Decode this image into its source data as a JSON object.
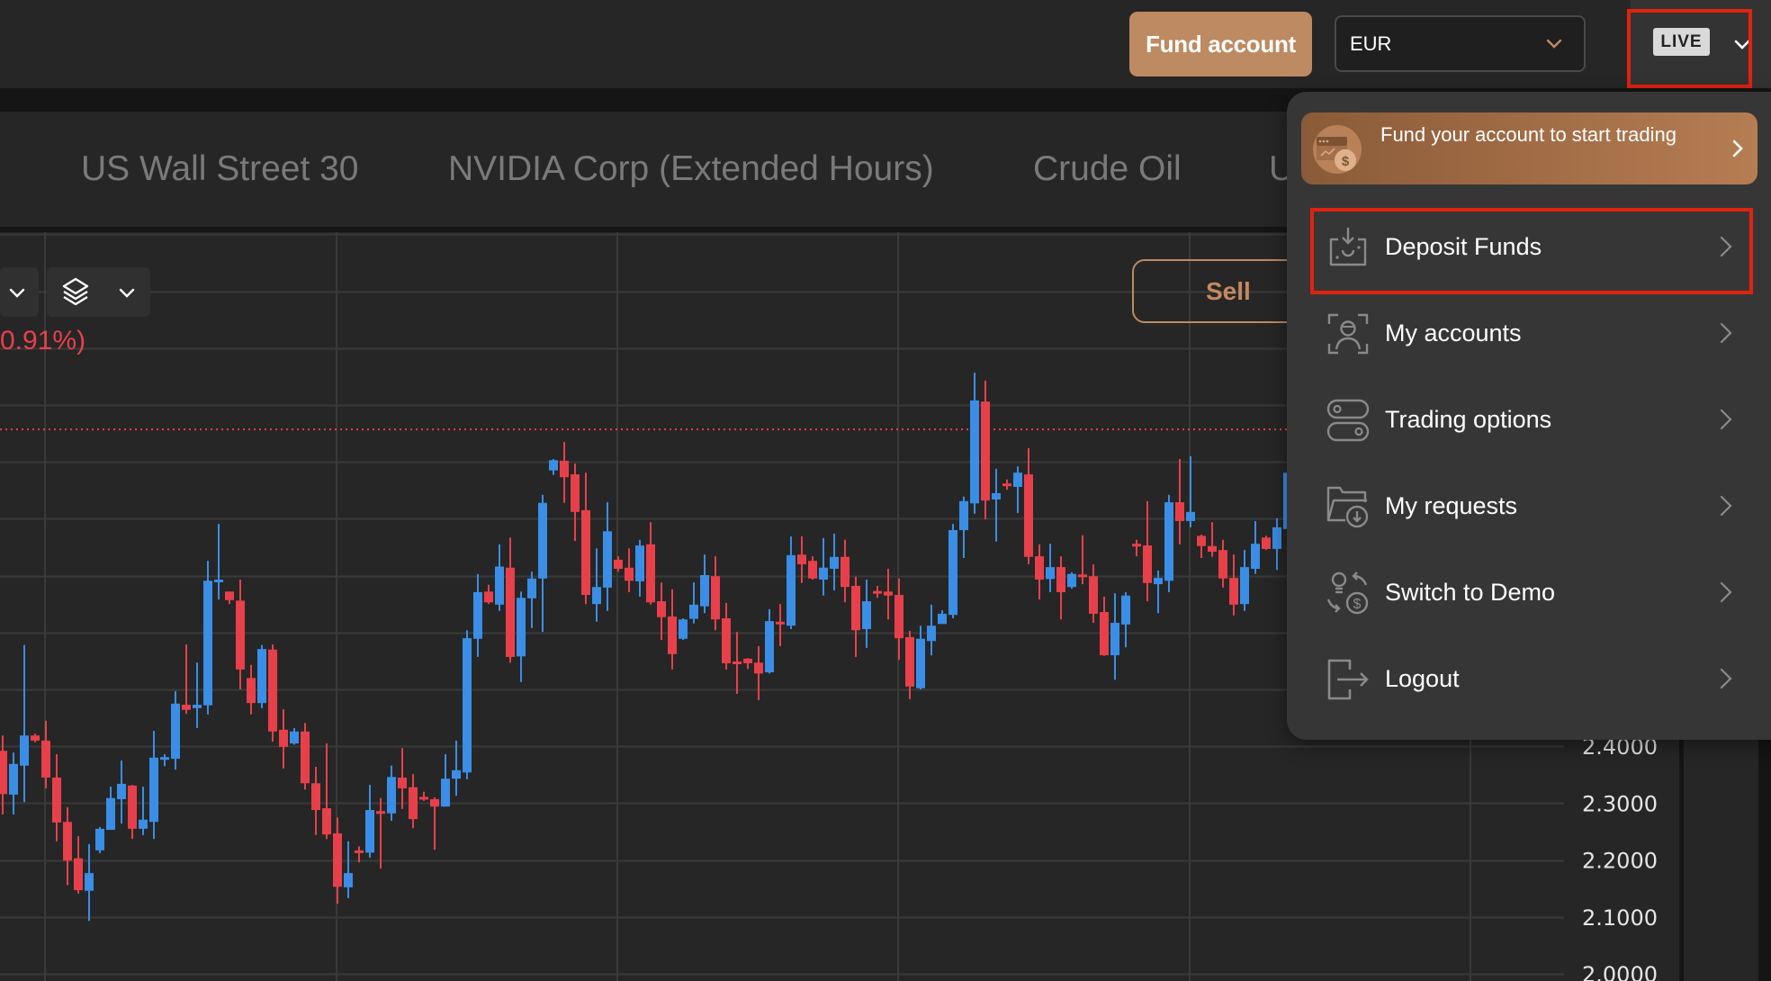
{
  "header": {
    "fund_button_label": "Fund account",
    "currency": {
      "selected": "EUR"
    },
    "account_mode_badge": "LIVE"
  },
  "tabs": [
    {
      "label": "US Wall Street 30"
    },
    {
      "label": "NVIDIA Corp (Extended Hours)"
    },
    {
      "label": "Crude Oil"
    },
    {
      "label": "U"
    }
  ],
  "chart_toolbar": {
    "change_text": "0.91%)",
    "sell_label": "Sell"
  },
  "menu": {
    "promo": {
      "label": "Fund your account to start trading"
    },
    "items": [
      {
        "label": "Deposit Funds",
        "icon": "deposit-icon"
      },
      {
        "label": "My accounts",
        "icon": "account-user-icon"
      },
      {
        "label": "Trading options",
        "icon": "toggles-icon"
      },
      {
        "label": "My requests",
        "icon": "folder-download-icon"
      },
      {
        "label": "Switch to Demo",
        "icon": "switch-demo-icon"
      },
      {
        "label": "Logout",
        "icon": "logout-icon"
      }
    ]
  },
  "colors": {
    "accent": "#bd8a62",
    "up": "#3a8ee6",
    "down": "#e8404a",
    "highlight": "#e0220f",
    "background": "#262626",
    "menu_bg": "#363636"
  },
  "chart_data": {
    "type": "candlestick",
    "title": "",
    "xlabel": "",
    "ylabel": "",
    "y_tick_labels": [
      "2.4000",
      "2.3000",
      "2.2000",
      "2.1000",
      "2.0000"
    ],
    "y_ticks": [
      2.4,
      2.3,
      2.2,
      2.1,
      2.0
    ],
    "ylim": [
      1.987,
      3.3
    ],
    "grid": true,
    "current_price_line": 2.957,
    "up_color": "#3a8ee6",
    "down_color": "#e8404a",
    "ohlc": [
      [
        2.392,
        2.419,
        2.28,
        2.316
      ],
      [
        2.315,
        2.389,
        2.28,
        2.369
      ],
      [
        2.366,
        2.578,
        2.302,
        2.419
      ],
      [
        2.419,
        2.422,
        2.407,
        2.41
      ],
      [
        2.41,
        2.445,
        2.326,
        2.345
      ],
      [
        2.345,
        2.386,
        2.233,
        2.266
      ],
      [
        2.267,
        2.293,
        2.156,
        2.199
      ],
      [
        2.203,
        2.242,
        2.141,
        2.147
      ],
      [
        2.146,
        2.228,
        2.093,
        2.177
      ],
      [
        2.217,
        2.258,
        2.212,
        2.255
      ],
      [
        2.253,
        2.329,
        2.253,
        2.309
      ],
      [
        2.307,
        2.375,
        2.264,
        2.334
      ],
      [
        2.331,
        2.332,
        2.237,
        2.255
      ],
      [
        2.255,
        2.329,
        2.244,
        2.271
      ],
      [
        2.267,
        2.427,
        2.237,
        2.38
      ],
      [
        2.379,
        2.386,
        2.365,
        2.381
      ],
      [
        2.378,
        2.497,
        2.359,
        2.475
      ],
      [
        2.473,
        2.579,
        2.457,
        2.464
      ],
      [
        2.467,
        2.547,
        2.432,
        2.473
      ],
      [
        2.472,
        2.726,
        2.456,
        2.691
      ],
      [
        2.69,
        2.791,
        2.658,
        2.693
      ],
      [
        2.672,
        2.672,
        2.65,
        2.657
      ],
      [
        2.656,
        2.693,
        2.5,
        2.535
      ],
      [
        2.52,
        2.543,
        2.456,
        2.476
      ],
      [
        2.476,
        2.578,
        2.467,
        2.571
      ],
      [
        2.57,
        2.579,
        2.408,
        2.426
      ],
      [
        2.429,
        2.465,
        2.361,
        2.399
      ],
      [
        2.405,
        2.432,
        2.403,
        2.426
      ],
      [
        2.426,
        2.441,
        2.324,
        2.335
      ],
      [
        2.335,
        2.364,
        2.244,
        2.288
      ],
      [
        2.291,
        2.405,
        2.237,
        2.245
      ],
      [
        2.247,
        2.275,
        2.123,
        2.153
      ],
      [
        2.152,
        2.233,
        2.133,
        2.177
      ],
      [
        2.217,
        2.224,
        2.196,
        2.214
      ],
      [
        2.213,
        2.332,
        2.204,
        2.288
      ],
      [
        2.286,
        2.309,
        2.185,
        2.283
      ],
      [
        2.282,
        2.366,
        2.269,
        2.346
      ],
      [
        2.345,
        2.397,
        2.29,
        2.326
      ],
      [
        2.328,
        2.351,
        2.256,
        2.272
      ],
      [
        2.311,
        2.32,
        2.304,
        2.309
      ],
      [
        2.307,
        2.31,
        2.218,
        2.294
      ],
      [
        2.294,
        2.386,
        2.294,
        2.343
      ],
      [
        2.343,
        2.41,
        2.313,
        2.358
      ],
      [
        2.354,
        2.604,
        2.342,
        2.59
      ],
      [
        2.589,
        2.703,
        2.557,
        2.671
      ],
      [
        2.672,
        2.684,
        2.65,
        2.653
      ],
      [
        2.649,
        2.755,
        2.638,
        2.716
      ],
      [
        2.714,
        2.767,
        2.547,
        2.557
      ],
      [
        2.558,
        2.672,
        2.513,
        2.661
      ],
      [
        2.66,
        2.707,
        2.608,
        2.695
      ],
      [
        2.695,
        2.842,
        2.601,
        2.828
      ],
      [
        2.885,
        2.905,
        2.877,
        2.903
      ],
      [
        2.902,
        2.935,
        2.828,
        2.873
      ],
      [
        2.878,
        2.897,
        2.761,
        2.812
      ],
      [
        2.815,
        2.881,
        2.65,
        2.666
      ],
      [
        2.65,
        2.748,
        2.619,
        2.68
      ],
      [
        2.679,
        2.829,
        2.638,
        2.778
      ],
      [
        2.728,
        2.734,
        2.707,
        2.712
      ],
      [
        2.714,
        2.748,
        2.671,
        2.691
      ],
      [
        2.69,
        2.763,
        2.663,
        2.753
      ],
      [
        2.755,
        2.794,
        2.649,
        2.653
      ],
      [
        2.655,
        2.688,
        2.587,
        2.627
      ],
      [
        2.628,
        2.676,
        2.535,
        2.562
      ],
      [
        2.589,
        2.625,
        2.587,
        2.623
      ],
      [
        2.624,
        2.688,
        2.616,
        2.649
      ],
      [
        2.646,
        2.737,
        2.634,
        2.701
      ],
      [
        2.699,
        2.734,
        2.604,
        2.623
      ],
      [
        2.625,
        2.652,
        2.535,
        2.546
      ],
      [
        2.549,
        2.601,
        2.492,
        2.547
      ],
      [
        2.554,
        2.555,
        2.536,
        2.546
      ],
      [
        2.547,
        2.576,
        2.481,
        2.528
      ],
      [
        2.53,
        2.641,
        2.528,
        2.62
      ],
      [
        2.619,
        2.65,
        2.576,
        2.617
      ],
      [
        2.612,
        2.769,
        2.606,
        2.736
      ],
      [
        2.737,
        2.769,
        2.687,
        2.72
      ],
      [
        2.726,
        2.734,
        2.693,
        2.695
      ],
      [
        2.693,
        2.766,
        2.665,
        2.714
      ],
      [
        2.712,
        2.774,
        2.674,
        2.733
      ],
      [
        2.733,
        2.763,
        2.653,
        2.68
      ],
      [
        2.682,
        2.698,
        2.557,
        2.604
      ],
      [
        2.606,
        2.693,
        2.573,
        2.655
      ],
      [
        2.673,
        2.682,
        2.661,
        2.671
      ],
      [
        2.672,
        2.712,
        2.623,
        2.665
      ],
      [
        2.666,
        2.695,
        2.552,
        2.59
      ],
      [
        2.592,
        2.603,
        2.483,
        2.505
      ],
      [
        2.502,
        2.612,
        2.5,
        2.589
      ],
      [
        2.585,
        2.649,
        2.56,
        2.612
      ],
      [
        2.615,
        2.639,
        2.616,
        2.633
      ],
      [
        2.631,
        2.791,
        2.625,
        2.78
      ],
      [
        2.78,
        2.839,
        2.731,
        2.831
      ],
      [
        2.827,
        3.057,
        2.809,
        3.008
      ],
      [
        3.006,
        3.043,
        2.799,
        2.832
      ],
      [
        2.834,
        2.888,
        2.76,
        2.845
      ],
      [
        2.862,
        2.869,
        2.851,
        2.86
      ],
      [
        2.856,
        2.892,
        2.81,
        2.881
      ],
      [
        2.878,
        2.924,
        2.72,
        2.733
      ],
      [
        2.734,
        2.755,
        2.658,
        2.693
      ],
      [
        2.694,
        2.756,
        2.671,
        2.715
      ],
      [
        2.715,
        2.734,
        2.623,
        2.671
      ],
      [
        2.68,
        2.706,
        2.677,
        2.703
      ],
      [
        2.702,
        2.771,
        2.685,
        2.7
      ],
      [
        2.699,
        2.72,
        2.617,
        2.633
      ],
      [
        2.636,
        2.663,
        2.559,
        2.56
      ],
      [
        2.56,
        2.669,
        2.517,
        2.617
      ],
      [
        2.614,
        2.671,
        2.574,
        2.665
      ],
      [
        2.756,
        2.763,
        2.734,
        2.754
      ],
      [
        2.753,
        2.831,
        2.655,
        2.687
      ],
      [
        2.685,
        2.709,
        2.634,
        2.696
      ],
      [
        2.691,
        2.842,
        2.671,
        2.829
      ],
      [
        2.829,
        2.905,
        2.755,
        2.796
      ],
      [
        2.796,
        2.91,
        2.785,
        2.812
      ],
      [
        2.77,
        2.772,
        2.731,
        2.752
      ],
      [
        2.752,
        2.794,
        2.733,
        2.742
      ],
      [
        2.745,
        2.763,
        2.679,
        2.695
      ],
      [
        2.696,
        2.737,
        2.63,
        2.649
      ],
      [
        2.65,
        2.745,
        2.638,
        2.715
      ],
      [
        2.712,
        2.796,
        2.703,
        2.756
      ],
      [
        2.767,
        2.77,
        2.745,
        2.747
      ],
      [
        2.747,
        2.801,
        2.71,
        2.785
      ],
      [
        2.782,
        2.927,
        2.769,
        2.881
      ]
    ]
  }
}
